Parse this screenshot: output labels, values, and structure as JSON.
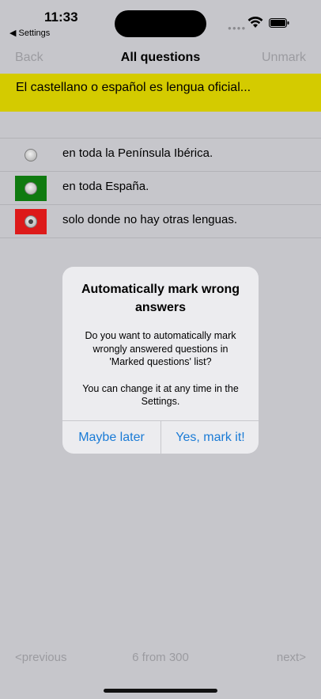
{
  "status": {
    "time": "11:33",
    "back_app": "◀ Settings"
  },
  "nav": {
    "back_label": "Back",
    "title": "All questions",
    "unmark_label": "Unmark"
  },
  "question": {
    "text": "El castellano o español es lengua oficial..."
  },
  "answers": [
    {
      "text": "en toda la Península Ibérica.",
      "color": "#c6c6cb"
    },
    {
      "text": "en toda España.",
      "color": "#0f7a10"
    },
    {
      "text": "solo donde no hay otras lenguas.",
      "color": "#dd1a1a"
    }
  ],
  "dialog": {
    "title": "Automatically mark wrong answers",
    "message_1": "Do you want to automatically mark wrongly answered questions in 'Marked questions' list?",
    "message_2": "You can change it at any time in the Settings.",
    "cancel_label": "Maybe later",
    "confirm_label": "Yes, mark it!"
  },
  "footer": {
    "prev_label": "<previous",
    "count_label": "6 from 300",
    "next_label": "next>"
  }
}
